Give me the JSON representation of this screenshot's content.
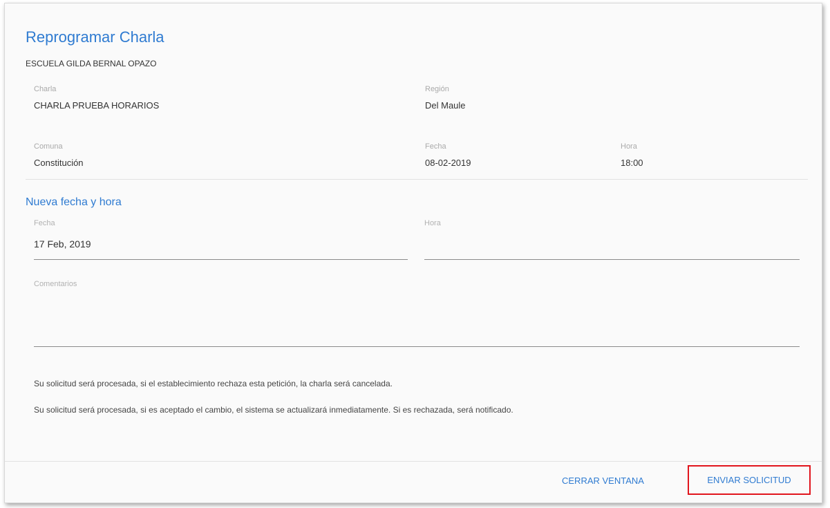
{
  "dialog": {
    "title": "Reprogramar Charla",
    "school": "ESCUELA GILDA BERNAL OPAZO"
  },
  "info": {
    "charla": {
      "label": "Charla",
      "value": "CHARLA PRUEBA HORARIOS"
    },
    "region": {
      "label": "Región",
      "value": "Del Maule"
    },
    "comuna": {
      "label": "Comuna",
      "value": "Constitución"
    },
    "fecha": {
      "label": "Fecha",
      "value": "08-02-2019"
    },
    "hora": {
      "label": "Hora",
      "value": "18:00"
    }
  },
  "new_schedule": {
    "title": "Nueva fecha y hora",
    "fecha": {
      "label": "Fecha",
      "value": "17 Feb, 2019"
    },
    "hora": {
      "label": "Hora",
      "value": ""
    },
    "comentarios": {
      "label": "Comentarios",
      "value": ""
    }
  },
  "notes": [
    "Su solicitud será procesada, si el establecimiento rechaza esta petición, la charla será cancelada.",
    "Su solicitud será procesada, si es aceptado el cambio, el sistema se actualizará inmediatamente. Si es rechazada, será notificado."
  ],
  "buttons": {
    "close": "CERRAR VENTANA",
    "send": "ENVIAR SOLICITUD"
  },
  "colors": {
    "accent": "#2f7bd1",
    "highlight": "#e1141c"
  }
}
